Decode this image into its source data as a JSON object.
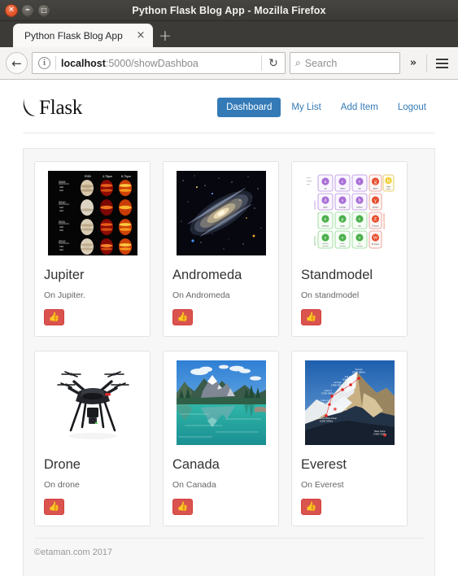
{
  "window": {
    "title": "Python Flask Blog App - Mozilla Firefox",
    "close_glyph": "×",
    "minimize_glyph": "–",
    "maximize_glyph": "□"
  },
  "browser": {
    "tab_title": "Python Flask Blog App",
    "tab_close_glyph": "×",
    "new_tab_glyph": "+",
    "back_glyph": "←",
    "info_glyph": "i",
    "url_host": "localhost",
    "url_path": ":5000/showDashboa",
    "reload_glyph": "↻",
    "search_icon_glyph": "⌕",
    "search_placeholder": "Search",
    "overflow_glyph": "»"
  },
  "site": {
    "brand": "Flask",
    "nav": [
      {
        "label": "Dashboard",
        "active": true
      },
      {
        "label": "My List",
        "active": false
      },
      {
        "label": "Add Item",
        "active": false
      },
      {
        "label": "Logout",
        "active": false
      }
    ],
    "footer": "©etaman.com 2017"
  },
  "cards": [
    {
      "title": "Jupiter",
      "desc": "On Jupiter.",
      "image": "jupiter-multiwavelength-thumbnail",
      "like_glyph": "👍"
    },
    {
      "title": "Andromeda",
      "desc": "On Andromeda",
      "image": "andromeda-galaxy-thumbnail",
      "like_glyph": "👍"
    },
    {
      "title": "Standmodel",
      "desc": "On standmodel",
      "image": "standard-model-particles-thumbnail",
      "like_glyph": "👍"
    },
    {
      "title": "Drone",
      "desc": "On drone",
      "image": "quadcopter-drone-thumbnail",
      "like_glyph": "👍"
    },
    {
      "title": "Canada",
      "desc": "On Canada",
      "image": "emerald-lake-canada-thumbnail",
      "like_glyph": "👍"
    },
    {
      "title": "Everest",
      "desc": "On Everest",
      "image": "mount-everest-routes-thumbnail",
      "like_glyph": "👍"
    }
  ],
  "colors": {
    "nav_active_bg": "#337ab7",
    "link": "#337ab7",
    "like_button": "#d9534f",
    "panel_bg": "#f7f7f7"
  }
}
